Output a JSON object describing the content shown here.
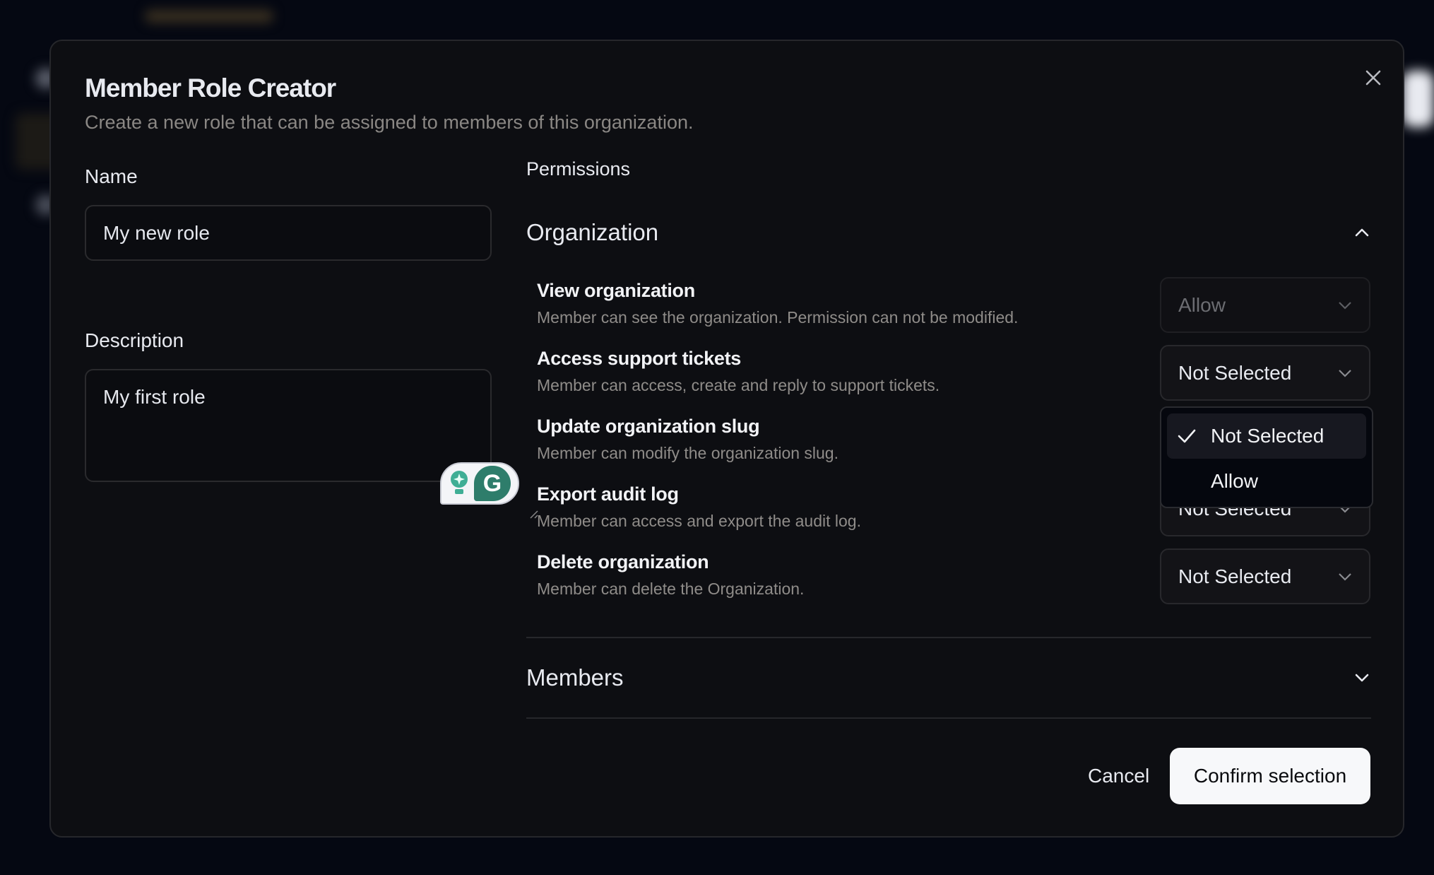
{
  "modal": {
    "title": "Member Role Creator",
    "subtitle": "Create a new role that can be assigned to members of this organization."
  },
  "form": {
    "name_label": "Name",
    "name_value": "My new role",
    "description_label": "Description",
    "description_value": "My first role"
  },
  "permissions": {
    "label": "Permissions",
    "sections": [
      {
        "title": "Organization",
        "expanded": true,
        "items": [
          {
            "title": "View organization",
            "description": "Member can see the organization. Permission can not be modified.",
            "value": "Allow",
            "disabled": true
          },
          {
            "title": "Access support tickets",
            "description": "Member can access, create and reply to support tickets.",
            "value": "Not Selected"
          },
          {
            "title": "Update organization slug",
            "description": "Member can modify the organization slug.",
            "value": "Not Selected"
          },
          {
            "title": "Export audit log",
            "description": "Member can access and export the audit log.",
            "value": "Not Selected"
          },
          {
            "title": "Delete organization",
            "description": "Member can delete the Organization.",
            "value": "Not Selected"
          }
        ]
      },
      {
        "title": "Members",
        "expanded": false
      }
    ],
    "open_dropdown": {
      "for_item": "Update organization slug",
      "options": [
        {
          "label": "Not Selected",
          "selected": true
        },
        {
          "label": "Allow",
          "selected": false
        }
      ]
    }
  },
  "actions": {
    "cancel": "Cancel",
    "confirm": "Confirm selection"
  }
}
